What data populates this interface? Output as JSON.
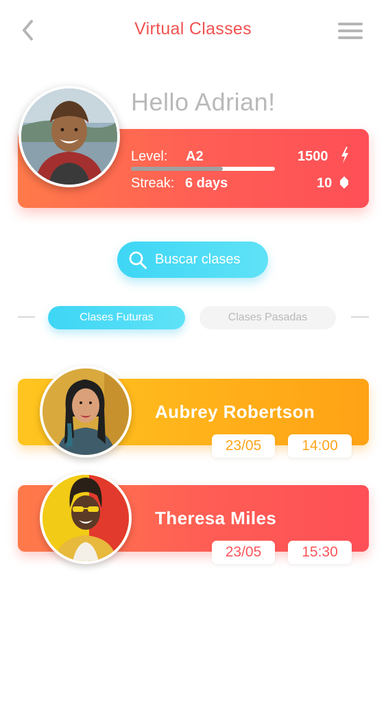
{
  "header": {
    "title": "Virtual Classes",
    "back_icon": "chevron-left-icon",
    "menu_icon": "hamburger-menu-icon",
    "title_color": "#f0524f"
  },
  "profile": {
    "greeting": "Hello Adrian!",
    "level_label": "Level:",
    "level_value": "A2",
    "level_progress": 0.64,
    "streak_label": "Streak:",
    "streak_value": "6 days",
    "points": "1500",
    "gems": "10",
    "points_icon": "lightning-bolt-icon",
    "gems_icon": "gem-icon",
    "card_colors": [
      "#ff7a4a",
      "#fe4f56"
    ]
  },
  "search": {
    "label": "Buscar clases",
    "icon": "search-icon",
    "color": "#3ed6f5"
  },
  "tabs": [
    {
      "label": "Clases Futuras",
      "active": true
    },
    {
      "label": "Clases Pasadas",
      "active": false
    }
  ],
  "classes": [
    {
      "teacher": "Aubrey Robertson",
      "date": "23/05",
      "time": "14:00",
      "colors": [
        "#ffc51f",
        "#ffa215"
      ]
    },
    {
      "teacher": "Theresa Miles",
      "date": "23/05",
      "time": "15:30",
      "colors": [
        "#ff7a4a",
        "#fe4f56"
      ]
    }
  ]
}
